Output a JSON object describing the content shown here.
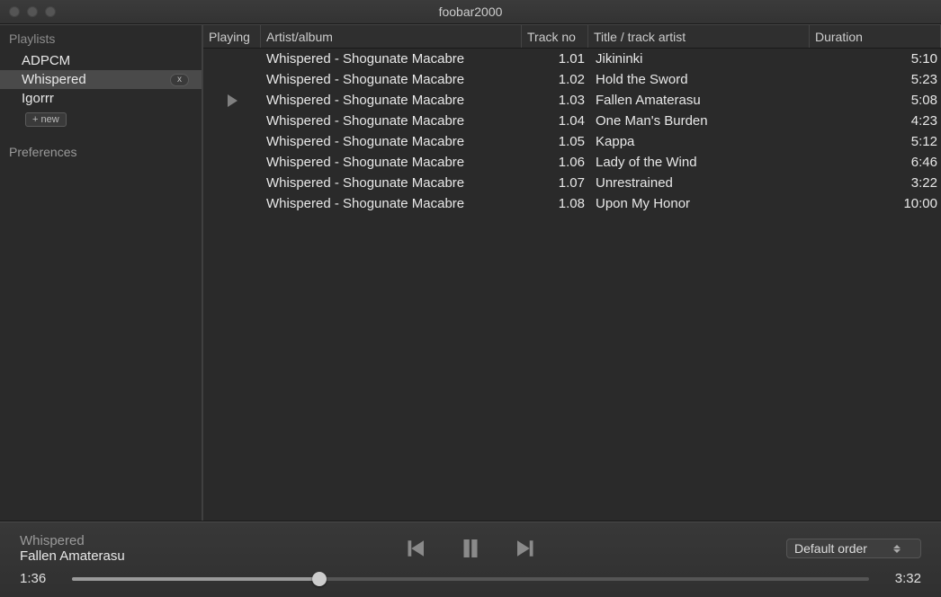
{
  "window": {
    "title": "foobar2000"
  },
  "sidebar": {
    "playlists_heading": "Playlists",
    "items": [
      {
        "label": "ADPCM"
      },
      {
        "label": "Whispered",
        "selected": true
      },
      {
        "label": "Igorrr"
      }
    ],
    "new_label": "+ new",
    "preferences_label": "Preferences"
  },
  "columns": {
    "playing": "Playing",
    "artist": "Artist/album",
    "trackno": "Track no",
    "title": "Title / track artist",
    "duration": "Duration"
  },
  "tracks": [
    {
      "playing": false,
      "artist": "Whispered - Shogunate Macabre",
      "trackno": "1.01",
      "title": "Jikininki",
      "duration": "5:10"
    },
    {
      "playing": false,
      "artist": "Whispered - Shogunate Macabre",
      "trackno": "1.02",
      "title": "Hold the Sword",
      "duration": "5:23"
    },
    {
      "playing": true,
      "artist": "Whispered - Shogunate Macabre",
      "trackno": "1.03",
      "title": "Fallen Amaterasu",
      "duration": "5:08"
    },
    {
      "playing": false,
      "artist": "Whispered - Shogunate Macabre",
      "trackno": "1.04",
      "title": "One Man's Burden",
      "duration": "4:23"
    },
    {
      "playing": false,
      "artist": "Whispered - Shogunate Macabre",
      "trackno": "1.05",
      "title": "Kappa",
      "duration": "5:12"
    },
    {
      "playing": false,
      "artist": "Whispered - Shogunate Macabre",
      "trackno": "1.06",
      "title": "Lady of the Wind",
      "duration": "6:46"
    },
    {
      "playing": false,
      "artist": "Whispered - Shogunate Macabre",
      "trackno": "1.07",
      "title": "Unrestrained",
      "duration": "3:22"
    },
    {
      "playing": false,
      "artist": "Whispered - Shogunate Macabre",
      "trackno": "1.08",
      "title": "Upon My Honor",
      "duration": "10:00"
    }
  ],
  "nowplaying": {
    "artist": "Whispered",
    "title": "Fallen Amaterasu",
    "elapsed": "1:36",
    "remaining": "3:32",
    "progress_pct": 31
  },
  "order": {
    "selected": "Default order"
  }
}
